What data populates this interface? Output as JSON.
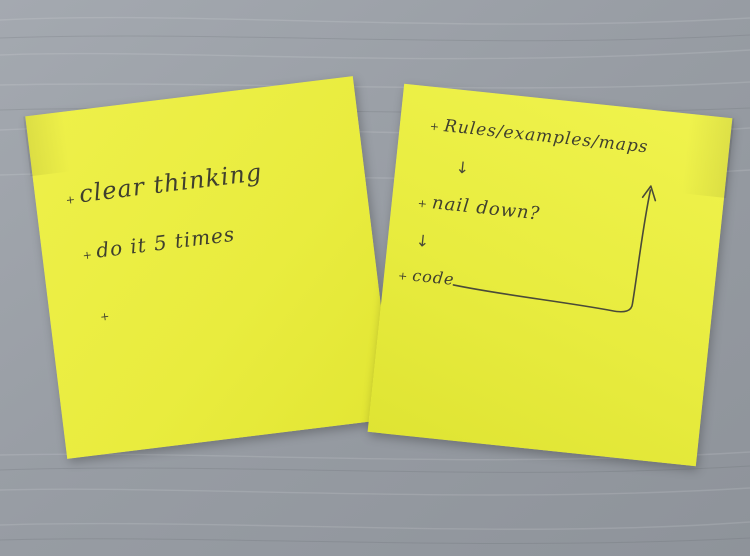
{
  "photo": {
    "surface": "wooden-table",
    "colors": {
      "table": "#9a9fa6",
      "note": "#eaed3f",
      "ink": "#3f3f2e"
    }
  },
  "notes": {
    "left": {
      "lines": [
        {
          "bullet": "+",
          "text": "clear thinking"
        },
        {
          "bullet": "+",
          "text": "do it 5 times"
        },
        {
          "bullet": "+",
          "text": ""
        }
      ]
    },
    "right": {
      "lines": [
        {
          "bullet": "+",
          "text": "Rules/examples/maps"
        },
        {
          "bullet": "+",
          "text": "nail down?"
        },
        {
          "bullet": "+",
          "text": "code"
        }
      ],
      "arrows": [
        "↓",
        "↓"
      ]
    }
  }
}
